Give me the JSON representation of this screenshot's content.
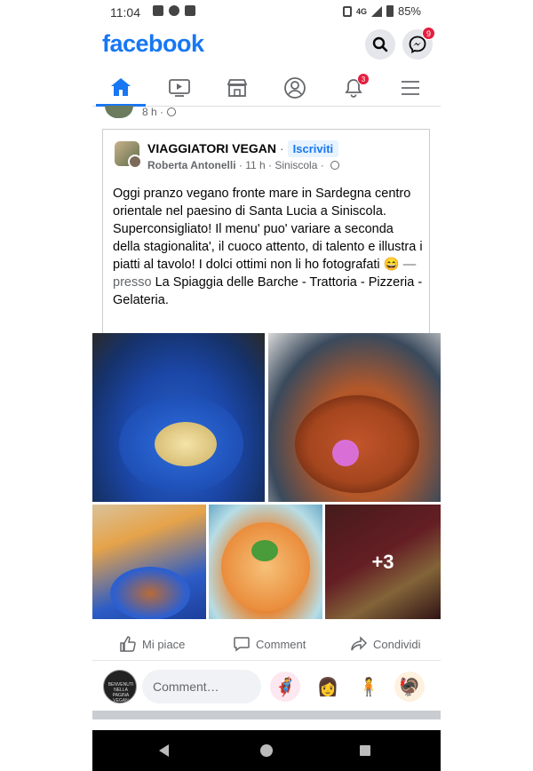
{
  "status_bar": {
    "time": "11:04",
    "network": "4G",
    "battery": "85%"
  },
  "header": {
    "logo": "facebook",
    "messenger_badge": "9"
  },
  "nav": {
    "notifications_badge": "3",
    "icons": [
      "home-icon",
      "watch-icon",
      "marketplace-icon",
      "profile-icon",
      "notifications-icon",
      "menu-icon"
    ]
  },
  "previous_post": {
    "time": "8 h ·"
  },
  "post": {
    "group_name": "VIAGGIATORI VEGAN",
    "separator": "·",
    "join_label": "Iscriviti",
    "author": "Roberta Antonelli",
    "time": "· 11 h · Siniscola ·",
    "text_para1": "Oggi pranzo vegano fronte mare in Sardegna centro orientale nel paesino di Santa Lucia a Siniscola.",
    "text_para2_main": "Superconsigliato! Il menu' puo' variare a seconda della stagionalita', il cuoco attento, di talento e illustra i piatti al tavolo! I dolci ottimi non li ho fotografati 😄",
    "text_presso": " — presso ",
    "place": "La Spiaggia delle Barche - Trattoria - Pizzeria - Gelateria",
    "text_end": ".",
    "more_photos": "+3"
  },
  "actions": {
    "like": "Mi piace",
    "comment": "Comment",
    "share": "Condividi"
  },
  "comment_box": {
    "placeholder": "Comment…",
    "avatar_text": "BENVENUTI NELLA PAGINA VEGAN",
    "stickers": [
      "🦸",
      "👩",
      "🧍",
      "🦃"
    ]
  },
  "colors": {
    "brand": "#1877f2",
    "badge": "#e41e3f",
    "secondary_text": "#65676b"
  }
}
